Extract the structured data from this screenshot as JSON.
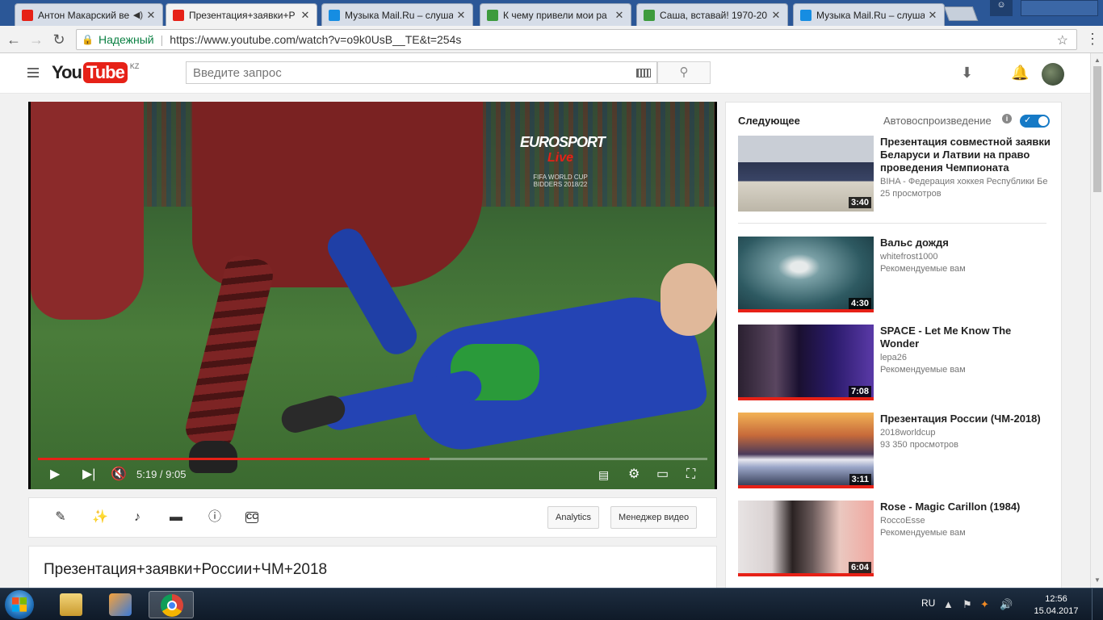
{
  "browser": {
    "tabs": [
      {
        "title": "Антон Макарский ве",
        "favicon_color": "#e62117",
        "audio": true
      },
      {
        "title": "Презентация+заявки+Р",
        "favicon_color": "#e62117",
        "active": true
      },
      {
        "title": "Музыка Mail.Ru – слуша",
        "favicon_color": "#168de2"
      },
      {
        "title": "К чему привели мои ра",
        "favicon_color": "#3d9b3d"
      },
      {
        "title": "Саша, вставай! 1970-20",
        "favicon_color": "#3d9b3d"
      },
      {
        "title": "Музыка Mail.Ru – слуша",
        "favicon_color": "#168de2"
      }
    ],
    "secure_label": "Надежный",
    "url": "https://www.youtube.com/watch?v=o9k0UsB__TE&t=254s"
  },
  "youtube": {
    "logo_you": "You",
    "logo_tube": "Tube",
    "region": "KZ",
    "search_placeholder": "Введите запрос"
  },
  "player": {
    "current_time": "5:19",
    "duration": "9:05",
    "time_display": "5:19 / 9:05",
    "progress_fraction": 0.585,
    "overlay_brand": "EUROSPORT",
    "overlay_live": "Live",
    "overlay_cup": "FIFA WORLD CUP\nBIDDERS 2018/22"
  },
  "toolbar": {
    "analytics_label": "Analytics",
    "manager_label": "Менеджер видео"
  },
  "video": {
    "title": "Презентация+заявки+России+ЧМ+2018"
  },
  "sidebar": {
    "next_label": "Следующее",
    "autoplay_label": "Автовоспроизведение",
    "autoplay_on": true,
    "items": [
      {
        "title": "Презентация совместной заявки Беларуси и Латвии на право проведения Чемпионата",
        "channel": "BIHA - Федерация хоккея Республики Бе",
        "info": "25 просмотров",
        "duration": "3:40",
        "thumb": "conference",
        "watched": false
      },
      {
        "title": "Вальс дождя",
        "channel": "whitefrost1000",
        "info": "Рекомендуемые вам",
        "duration": "4:30",
        "thumb": "rain",
        "watched": true
      },
      {
        "title": "SPACE - Let Me Know The Wonder",
        "channel": "lepa26",
        "info": "Рекомендуемые вам",
        "duration": "7:08",
        "thumb": "concert",
        "watched": true
      },
      {
        "title": "Презентация России (ЧМ-2018)",
        "channel": "2018worldcup",
        "info": "93 350 просмотров",
        "duration": "3:11",
        "thumb": "stadium",
        "watched": true
      },
      {
        "title": "Rose - Magic Carillon (1984)",
        "channel": "RoccoEsse",
        "info": "Рекомендуемые вам",
        "duration": "6:04",
        "thumb": "album",
        "watched": true
      }
    ]
  },
  "taskbar": {
    "language": "RU",
    "time": "12:56",
    "date": "15.04.2017"
  },
  "colors": {
    "youtube_red": "#e62117",
    "toggle_blue": "#167ac6",
    "secure_green": "#0b8043"
  }
}
